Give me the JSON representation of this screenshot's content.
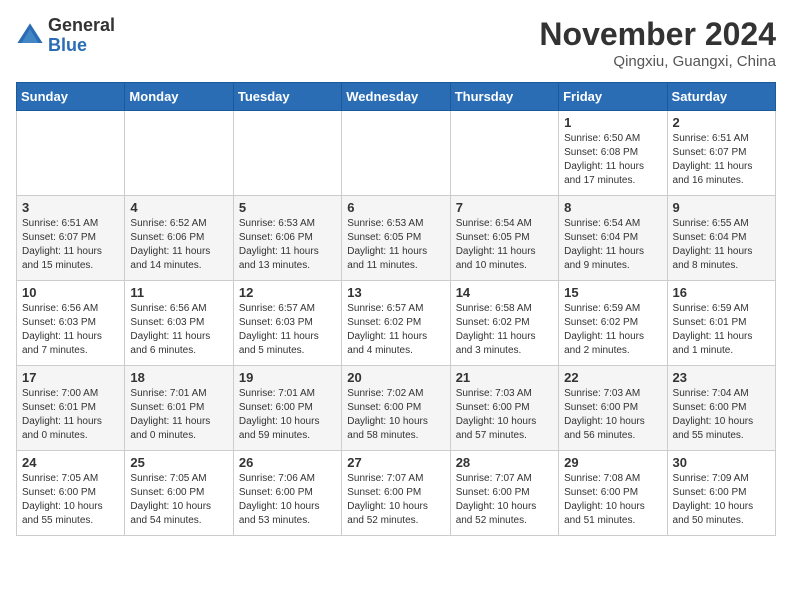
{
  "header": {
    "logo_general": "General",
    "logo_blue": "Blue",
    "month_title": "November 2024",
    "location": "Qingxiu, Guangxi, China"
  },
  "weekdays": [
    "Sunday",
    "Monday",
    "Tuesday",
    "Wednesday",
    "Thursday",
    "Friday",
    "Saturday"
  ],
  "weeks": [
    [
      {
        "day": "",
        "detail": ""
      },
      {
        "day": "",
        "detail": ""
      },
      {
        "day": "",
        "detail": ""
      },
      {
        "day": "",
        "detail": ""
      },
      {
        "day": "",
        "detail": ""
      },
      {
        "day": "1",
        "detail": "Sunrise: 6:50 AM\nSunset: 6:08 PM\nDaylight: 11 hours\nand 17 minutes."
      },
      {
        "day": "2",
        "detail": "Sunrise: 6:51 AM\nSunset: 6:07 PM\nDaylight: 11 hours\nand 16 minutes."
      }
    ],
    [
      {
        "day": "3",
        "detail": "Sunrise: 6:51 AM\nSunset: 6:07 PM\nDaylight: 11 hours\nand 15 minutes."
      },
      {
        "day": "4",
        "detail": "Sunrise: 6:52 AM\nSunset: 6:06 PM\nDaylight: 11 hours\nand 14 minutes."
      },
      {
        "day": "5",
        "detail": "Sunrise: 6:53 AM\nSunset: 6:06 PM\nDaylight: 11 hours\nand 13 minutes."
      },
      {
        "day": "6",
        "detail": "Sunrise: 6:53 AM\nSunset: 6:05 PM\nDaylight: 11 hours\nand 11 minutes."
      },
      {
        "day": "7",
        "detail": "Sunrise: 6:54 AM\nSunset: 6:05 PM\nDaylight: 11 hours\nand 10 minutes."
      },
      {
        "day": "8",
        "detail": "Sunrise: 6:54 AM\nSunset: 6:04 PM\nDaylight: 11 hours\nand 9 minutes."
      },
      {
        "day": "9",
        "detail": "Sunrise: 6:55 AM\nSunset: 6:04 PM\nDaylight: 11 hours\nand 8 minutes."
      }
    ],
    [
      {
        "day": "10",
        "detail": "Sunrise: 6:56 AM\nSunset: 6:03 PM\nDaylight: 11 hours\nand 7 minutes."
      },
      {
        "day": "11",
        "detail": "Sunrise: 6:56 AM\nSunset: 6:03 PM\nDaylight: 11 hours\nand 6 minutes."
      },
      {
        "day": "12",
        "detail": "Sunrise: 6:57 AM\nSunset: 6:03 PM\nDaylight: 11 hours\nand 5 minutes."
      },
      {
        "day": "13",
        "detail": "Sunrise: 6:57 AM\nSunset: 6:02 PM\nDaylight: 11 hours\nand 4 minutes."
      },
      {
        "day": "14",
        "detail": "Sunrise: 6:58 AM\nSunset: 6:02 PM\nDaylight: 11 hours\nand 3 minutes."
      },
      {
        "day": "15",
        "detail": "Sunrise: 6:59 AM\nSunset: 6:02 PM\nDaylight: 11 hours\nand 2 minutes."
      },
      {
        "day": "16",
        "detail": "Sunrise: 6:59 AM\nSunset: 6:01 PM\nDaylight: 11 hours\nand 1 minute."
      }
    ],
    [
      {
        "day": "17",
        "detail": "Sunrise: 7:00 AM\nSunset: 6:01 PM\nDaylight: 11 hours\nand 0 minutes."
      },
      {
        "day": "18",
        "detail": "Sunrise: 7:01 AM\nSunset: 6:01 PM\nDaylight: 11 hours\nand 0 minutes."
      },
      {
        "day": "19",
        "detail": "Sunrise: 7:01 AM\nSunset: 6:00 PM\nDaylight: 10 hours\nand 59 minutes."
      },
      {
        "day": "20",
        "detail": "Sunrise: 7:02 AM\nSunset: 6:00 PM\nDaylight: 10 hours\nand 58 minutes."
      },
      {
        "day": "21",
        "detail": "Sunrise: 7:03 AM\nSunset: 6:00 PM\nDaylight: 10 hours\nand 57 minutes."
      },
      {
        "day": "22",
        "detail": "Sunrise: 7:03 AM\nSunset: 6:00 PM\nDaylight: 10 hours\nand 56 minutes."
      },
      {
        "day": "23",
        "detail": "Sunrise: 7:04 AM\nSunset: 6:00 PM\nDaylight: 10 hours\nand 55 minutes."
      }
    ],
    [
      {
        "day": "24",
        "detail": "Sunrise: 7:05 AM\nSunset: 6:00 PM\nDaylight: 10 hours\nand 55 minutes."
      },
      {
        "day": "25",
        "detail": "Sunrise: 7:05 AM\nSunset: 6:00 PM\nDaylight: 10 hours\nand 54 minutes."
      },
      {
        "day": "26",
        "detail": "Sunrise: 7:06 AM\nSunset: 6:00 PM\nDaylight: 10 hours\nand 53 minutes."
      },
      {
        "day": "27",
        "detail": "Sunrise: 7:07 AM\nSunset: 6:00 PM\nDaylight: 10 hours\nand 52 minutes."
      },
      {
        "day": "28",
        "detail": "Sunrise: 7:07 AM\nSunset: 6:00 PM\nDaylight: 10 hours\nand 52 minutes."
      },
      {
        "day": "29",
        "detail": "Sunrise: 7:08 AM\nSunset: 6:00 PM\nDaylight: 10 hours\nand 51 minutes."
      },
      {
        "day": "30",
        "detail": "Sunrise: 7:09 AM\nSunset: 6:00 PM\nDaylight: 10 hours\nand 50 minutes."
      }
    ]
  ]
}
